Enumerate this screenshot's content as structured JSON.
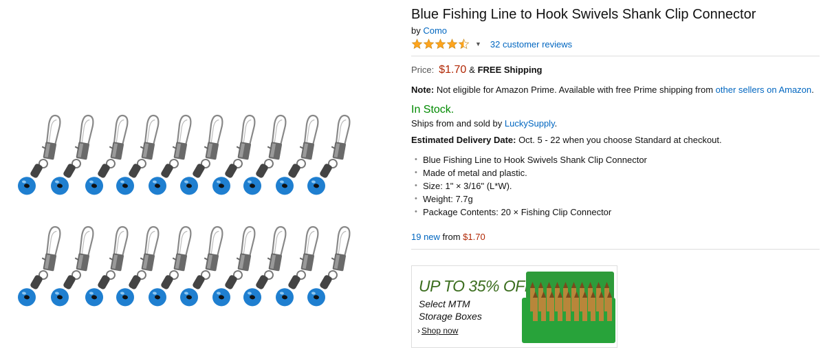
{
  "product": {
    "title": "Blue Fishing Line to Hook Swivels Shank Clip Connector",
    "by_label": "by",
    "brand": "Como",
    "rating_stars": 4.5,
    "reviews_text": "32 customer reviews",
    "price_label": "Price:",
    "price": "$1.70",
    "shipping_prefix": "&",
    "shipping": "FREE Shipping",
    "note_label": "Note:",
    "note_text": " Not eligible for Amazon Prime. Available with free Prime shipping from ",
    "note_link": "other sellers on Amazon",
    "note_end": ".",
    "stock": "In Stock.",
    "ships_text": "Ships from and sold by ",
    "seller": "LuckySupply",
    "ships_end": ".",
    "delivery_label": "Estimated Delivery Date:",
    "delivery_text": " Oct. 5 - 22 when you choose Standard at checkout.",
    "bullets": [
      "Blue Fishing Line to Hook Swivels Shank Clip Connector",
      "Made of metal and plastic.",
      "Size: 1\" × 3/16\" (L*W).",
      "Weight: 7.7g",
      "Package Contents: 20 × Fishing Clip Connector"
    ],
    "offers_new": "19 new",
    "offers_from": " from ",
    "offers_price": "$1.70"
  },
  "ad": {
    "headline": "UP TO 35% OFF",
    "line1": "Select MTM",
    "line2": "Storage Boxes",
    "cta_arrow": "›",
    "cta": "Shop now"
  },
  "colors": {
    "link": "#0066c0",
    "price": "#b12704",
    "stock": "#008a00",
    "star": "#ffa41c",
    "bead": "#1f7fd0",
    "ad_green": "#3c6e1f"
  }
}
